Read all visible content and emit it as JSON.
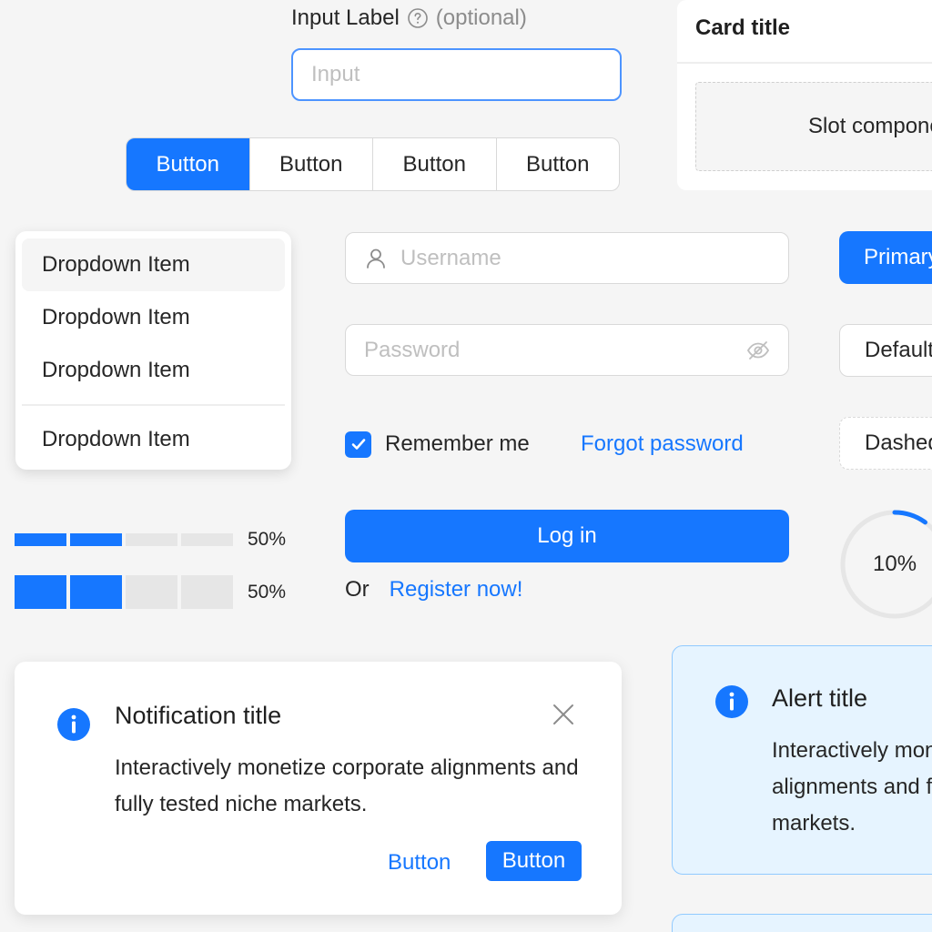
{
  "input": {
    "label": "Input Label",
    "optional": "(optional)",
    "placeholder": "Input"
  },
  "segmented": [
    "Button",
    "Button",
    "Button",
    "Button"
  ],
  "card": {
    "title": "Card title",
    "slot": "Slot component"
  },
  "dropdown": {
    "items": [
      "Dropdown Item",
      "Dropdown Item",
      "Dropdown Item",
      "Dropdown Item"
    ]
  },
  "login": {
    "username_placeholder": "Username",
    "password_placeholder": "Password",
    "remember": "Remember me",
    "remember_checked": true,
    "forgot": "Forgot password",
    "submit": "Log in",
    "or": "Or",
    "register": "Register now!"
  },
  "buttons": {
    "primary": "Primary",
    "default": "Default",
    "dashed": "Dashed"
  },
  "progress": {
    "steps_small": {
      "percent": 50,
      "label": "50%"
    },
    "steps_large": {
      "percent": 50,
      "label": "50%"
    },
    "circle": {
      "percent": 10,
      "label": "10%"
    }
  },
  "notification": {
    "title": "Notification title",
    "body": "Interactively monetize corporate alignments and fully tested niche markets.",
    "link_button": "Button",
    "primary_button": "Button"
  },
  "alert": {
    "title": "Alert title",
    "body_lines": [
      "Interactively monetize corporate",
      "alignments and fully tested niche",
      "markets."
    ]
  },
  "colors": {
    "primary": "#1677ff",
    "alert_bg": "#e6f4ff",
    "alert_border": "#91caff"
  }
}
